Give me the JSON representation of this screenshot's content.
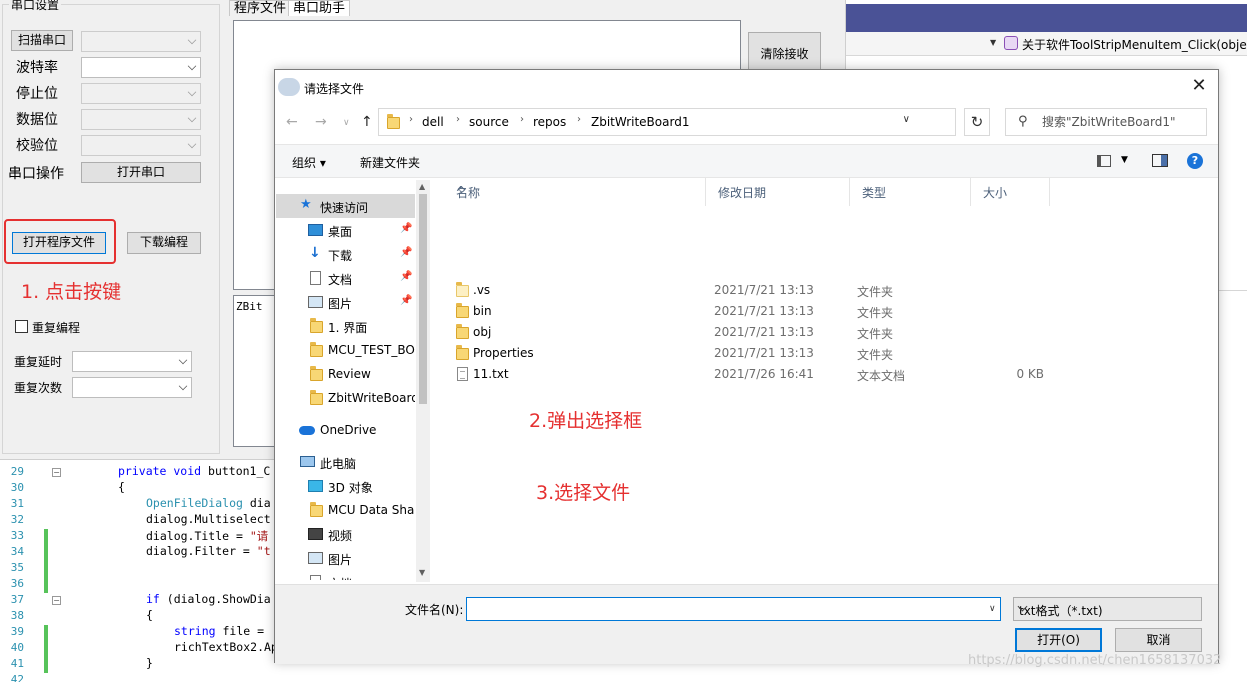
{
  "ide": {
    "method_selector": "关于软件ToolStripMenuItem_Click(objec",
    "line_numbers": [
      "29",
      "30",
      "31",
      "32",
      "33",
      "34",
      "35",
      "36",
      "37",
      "38",
      "39",
      "40",
      "41",
      "42"
    ],
    "code_lines": [
      {
        "kw": "private void ",
        "rest": "button1_C"
      },
      {
        "kw": "",
        "rest": "{"
      },
      {
        "ty": "OpenFileDialog ",
        "rest": "dia"
      },
      {
        "kw": "",
        "rest": "dialog.Multiselect"
      },
      {
        "kw": "",
        "rest": "dialog.Title = ",
        "str": "\"请"
      },
      {
        "kw": "",
        "rest": "dialog.Filter = ",
        "str": "\"t"
      },
      {
        "kw": "",
        "rest": ""
      },
      {
        "kw": "",
        "rest": ""
      },
      {
        "kw": "if ",
        "rest": "(dialog.ShowDia"
      },
      {
        "kw": "",
        "rest": "{"
      },
      {
        "kw": "string ",
        "rest": "file = "
      },
      {
        "kw": "",
        "rest": "richTextBox2.Ap"
      },
      {
        "kw": "",
        "rest": "}"
      },
      {
        "kw": "",
        "rest": ""
      }
    ]
  },
  "form": {
    "group_title": "串口设置",
    "labels": {
      "scan_port": "扫描串口",
      "baud": "波特率",
      "stop_bits": "停止位",
      "data_bits": "数据位",
      "parity": "校验位",
      "port_op": "串口操作",
      "repeat_delay": "重复延时",
      "repeat_count": "重复次数",
      "repeat_program": "重复编程"
    },
    "buttons": {
      "open_port": "打开串口",
      "open_program_file": "打开程序文件",
      "download_program": "下载编程",
      "clear_receive": "清除接收"
    },
    "tabs": [
      "程序文件",
      "串口助手"
    ],
    "tx_text": "ZBit"
  },
  "annotations": {
    "step1": "1. 点击按键",
    "step2": "2.弹出选择框",
    "step3": "3.选择文件"
  },
  "dialog": {
    "title": "请选择文件",
    "close": "✕",
    "breadcrumbs": [
      "dell",
      "source",
      "repos",
      "ZbitWriteBoard1"
    ],
    "search_placeholder": "搜索\"ZbitWriteBoard1\"",
    "organize": "组织 ▾",
    "new_folder": "新建文件夹",
    "nav_items": [
      {
        "label": "快速访问",
        "icon": "star-icon"
      },
      {
        "label": "桌面",
        "icon": "desktop-icon",
        "pinned": true
      },
      {
        "label": "下载",
        "icon": "download-icon",
        "pinned": true
      },
      {
        "label": "文档",
        "icon": "document-icon",
        "pinned": true
      },
      {
        "label": "图片",
        "icon": "picture-icon",
        "pinned": true
      },
      {
        "label": "1. 界面",
        "icon": "folder-icon"
      },
      {
        "label": "MCU_TEST_BO.",
        "icon": "folder-icon"
      },
      {
        "label": "Review",
        "icon": "folder-icon"
      },
      {
        "label": "ZbitWriteBoard",
        "icon": "folder-icon"
      },
      {
        "label": "OneDrive",
        "icon": "cloud-icon"
      },
      {
        "label": "此电脑",
        "icon": "computer-icon"
      },
      {
        "label": "3D 对象",
        "icon": "3d-objects-icon"
      },
      {
        "label": "MCU Data Sha",
        "icon": "folder-icon"
      },
      {
        "label": "视频",
        "icon": "video-icon"
      },
      {
        "label": "图片",
        "icon": "picture-icon"
      },
      {
        "label": "文档",
        "icon": "document-icon"
      }
    ],
    "columns": [
      "名称",
      "修改日期",
      "类型",
      "大小"
    ],
    "files": [
      {
        "name": ".vs",
        "date": "2021/7/21 13:13",
        "type": "文件夹",
        "size": "",
        "icon": "folder-icon"
      },
      {
        "name": "bin",
        "date": "2021/7/21 13:13",
        "type": "文件夹",
        "size": "",
        "icon": "folder-icon"
      },
      {
        "name": "obj",
        "date": "2021/7/21 13:13",
        "type": "文件夹",
        "size": "",
        "icon": "folder-icon"
      },
      {
        "name": "Properties",
        "date": "2021/7/21 13:13",
        "type": "文件夹",
        "size": "",
        "icon": "folder-icon"
      },
      {
        "name": "11.txt",
        "date": "2021/7/26 16:41",
        "type": "文本文档",
        "size": "0 KB",
        "icon": "text-file-icon"
      }
    ],
    "filename_label": "文件名(N):",
    "filename_value": "",
    "filter_value": "txt格式（*.txt)",
    "open_button": "打开(O)",
    "cancel_button": "取消"
  },
  "watermark": "https://blog.csdn.net/chen1658137032"
}
